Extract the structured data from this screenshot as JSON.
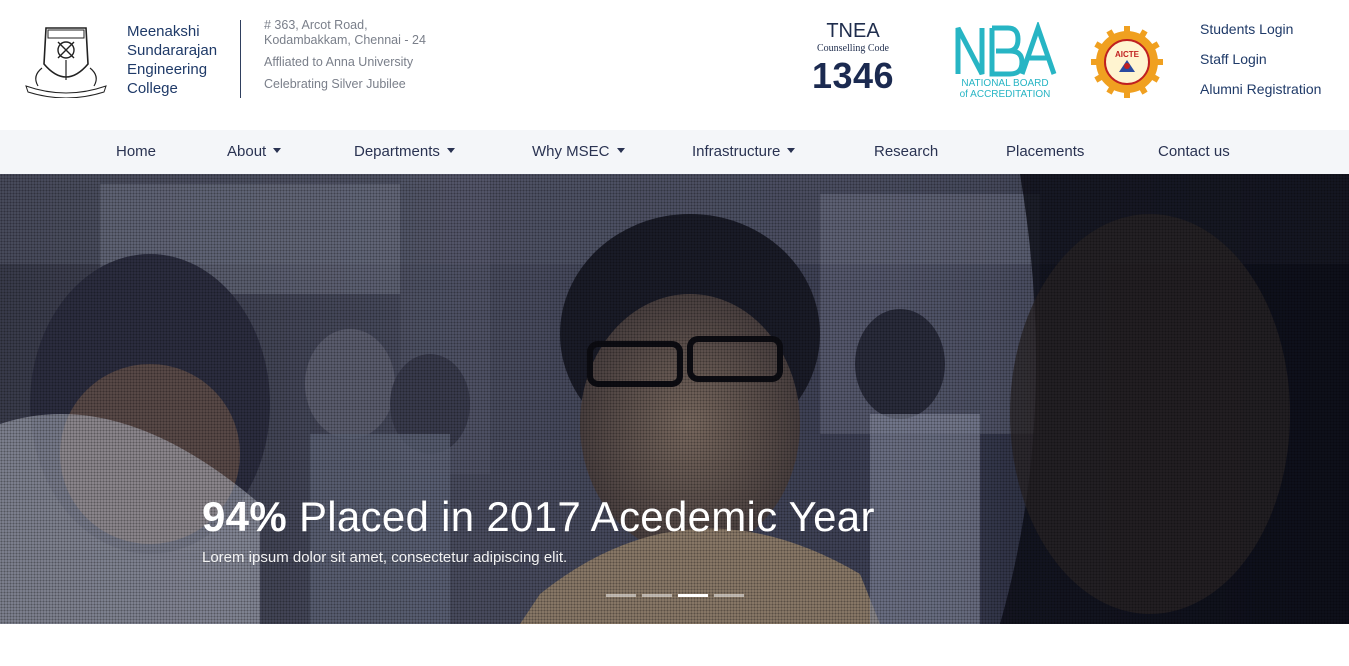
{
  "college": {
    "name_lines": [
      "Meenakshi",
      "Sundararajan",
      "Engineering",
      "College"
    ],
    "address_line1": "# 363, Arcot Road,",
    "address_line2": "Kodambakkam, Chennai - 24",
    "affiliation": "Affliated to Anna University",
    "jubilee": "Celebrating Silver Jubilee"
  },
  "tnea": {
    "title": "TNEA",
    "subtitle": "Counselling Code",
    "code": "1346"
  },
  "badges": {
    "nba_line1": "NATIONAL BOARD",
    "nba_line2": "of ACCREDITATION",
    "aicte_label": "AICTE"
  },
  "login_links": [
    "Students Login",
    "Staff Login",
    "Alumni Registration"
  ],
  "nav": [
    {
      "label": "Home",
      "dropdown": false
    },
    {
      "label": "About",
      "dropdown": true
    },
    {
      "label": "Departments",
      "dropdown": true
    },
    {
      "label": "Why MSEC",
      "dropdown": true
    },
    {
      "label": "Infrastructure",
      "dropdown": true
    },
    {
      "label": "Research",
      "dropdown": false
    },
    {
      "label": "Placements",
      "dropdown": false
    },
    {
      "label": "Contact us",
      "dropdown": false
    }
  ],
  "hero": {
    "title_bold": "94%",
    "title_rest": " Placed in 2017 Acedemic Year",
    "subtitle": "Lorem ipsum dolor sit amet, consectetur adipiscing elit.",
    "slide_count": 4,
    "active_slide": 3
  },
  "colors": {
    "brand_navy": "#1f3a68",
    "nav_bg": "#f4f6f9",
    "nba_teal": "#27b5c4",
    "aicte_orange": "#f0a020"
  }
}
